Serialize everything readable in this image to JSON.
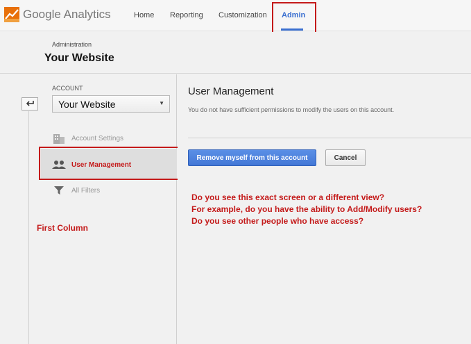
{
  "header": {
    "logo_text": "Google Analytics",
    "nav": {
      "home": "Home",
      "reporting": "Reporting",
      "customization": "Customization",
      "admin": "Admin"
    }
  },
  "admin_bar": {
    "label": "Administration",
    "site_name": "Your Website"
  },
  "sidebar": {
    "account_label": "ACCOUNT",
    "account_selected": "Your Website",
    "items": [
      {
        "label": "Account Settings",
        "icon": "building-icon",
        "active": false
      },
      {
        "label": "User Management",
        "icon": "users-icon",
        "active": true
      },
      {
        "label": "All Filters",
        "icon": "filter-icon",
        "active": false
      }
    ],
    "annotation": "First Column"
  },
  "main": {
    "title": "User Management",
    "subtitle": "You do not have sufficient permissions to modify the users on this account.",
    "remove_button": "Remove myself from this account",
    "cancel_button": "Cancel",
    "notes": [
      "Do you see this exact screen or a different view?",
      "For example, do you have the ability to Add/Modify users?",
      "Do you see other people who have access?"
    ]
  },
  "colors": {
    "accent": "#3a6fd0",
    "annotation_red": "#c41a1a",
    "primary_button": "#4a80dc"
  }
}
